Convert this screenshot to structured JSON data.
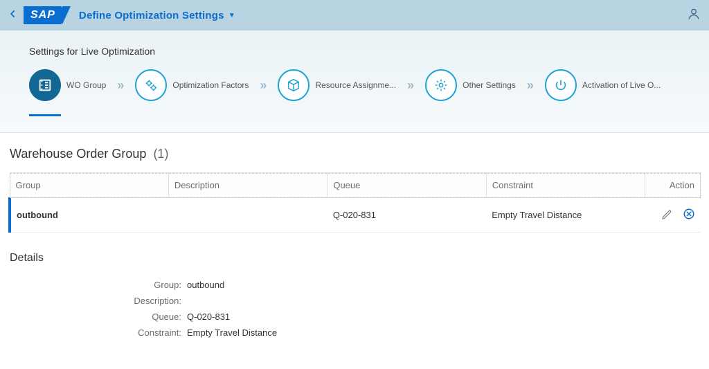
{
  "header": {
    "logo_text": "SAP",
    "title": "Define Optimization Settings"
  },
  "wizard": {
    "title": "Settings for Live Optimization",
    "steps": [
      {
        "label": "WO Group",
        "icon": "list-icon"
      },
      {
        "label": "Optimization Factors",
        "icon": "gears-icon"
      },
      {
        "label": "Resource Assignme...",
        "icon": "cube-icon"
      },
      {
        "label": "Other Settings",
        "icon": "gear-icon"
      },
      {
        "label": "Activation of Live O...",
        "icon": "power-icon"
      }
    ]
  },
  "table": {
    "title_base": "Warehouse Order Group",
    "count": "(1)",
    "columns": {
      "group": "Group",
      "description": "Description",
      "queue": "Queue",
      "constraint": "Constraint",
      "action": "Action"
    },
    "rows": [
      {
        "group": "outbound",
        "description": "",
        "queue": "Q-020-831",
        "constraint": "Empty Travel Distance"
      }
    ]
  },
  "details": {
    "title": "Details",
    "labels": {
      "group": "Group:",
      "description": "Description:",
      "queue": "Queue:",
      "constraint": "Constraint:"
    },
    "values": {
      "group": "outbound",
      "description": "",
      "queue": "Q-020-831",
      "constraint": "Empty Travel Distance"
    }
  }
}
